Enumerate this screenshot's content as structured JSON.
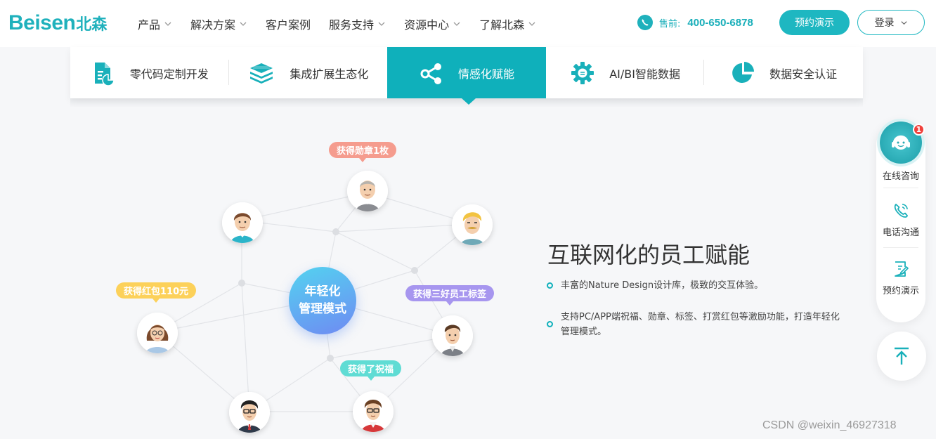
{
  "header": {
    "logo_en": "Beisen",
    "logo_cn": "北森",
    "nav": [
      {
        "label": "产品",
        "has_dropdown": true
      },
      {
        "label": "解决方案",
        "has_dropdown": true
      },
      {
        "label": "客户案例",
        "has_dropdown": false
      },
      {
        "label": "服务支持",
        "has_dropdown": true
      },
      {
        "label": "资源中心",
        "has_dropdown": true
      },
      {
        "label": "了解北森",
        "has_dropdown": true
      }
    ],
    "phone_label": "售前:",
    "phone_number": "400-650-6878",
    "demo_button": "预约演示",
    "login_button": "登录"
  },
  "tabs": [
    {
      "label": "零代码定制开发",
      "icon": "document-chart-icon",
      "active": false
    },
    {
      "label": "集成扩展生态化",
      "icon": "stacked-layers-icon",
      "active": false
    },
    {
      "label": "情感化赋能",
      "icon": "share-icon",
      "active": true
    },
    {
      "label": "AI/BI智能数据",
      "icon": "gear-icon",
      "active": false
    },
    {
      "label": "数据安全认证",
      "icon": "pie-chart-icon",
      "active": false
    }
  ],
  "illustration": {
    "center_line1": "年轻化",
    "center_line2": "管理模式",
    "tags": {
      "medal": "获得勋章1枚",
      "red_packet": "获得红包110元",
      "badge_label": "获得三好员工标签",
      "blessing": "获得了祝福"
    }
  },
  "content": {
    "title": "互联网化的员工赋能",
    "bullets": [
      {
        "line1": "丰富的Nature Design设计库，极致的交互体验。",
        "line2": ""
      },
      {
        "line1": "支持PC/APP端祝福、勋章、标签、打赏红包等激励功能，打造年轻化",
        "line2": "管理模式。"
      }
    ]
  },
  "sidebar": {
    "consult": "在线咨询",
    "consult_badge": "1",
    "phone": "电话沟通",
    "demo": "预约演示"
  },
  "watermark": "CSDN @weixin_46927318",
  "colors": {
    "brand": "#1fb1bc",
    "tab_active": "#0fb0bb",
    "tag_medal": "#f59c8e",
    "tag_red_packet": "#fcd15a",
    "tag_badge_label": "#a796ef",
    "tag_blessing": "#5fdcd4"
  }
}
